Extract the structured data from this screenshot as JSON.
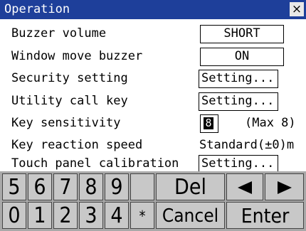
{
  "window": {
    "title": "Operation",
    "close_label": "×"
  },
  "settings": [
    {
      "label": "Buzzer volume",
      "value": "SHORT"
    },
    {
      "label": "Window move buzzer",
      "value": "ON"
    },
    {
      "label": "Security setting",
      "value": "Setting..."
    },
    {
      "label": "Utility call key",
      "value": "Setting..."
    },
    {
      "label": "Key sensitivity",
      "value": "8",
      "note": "(Max 8)"
    },
    {
      "label": "Key reaction speed",
      "value": "Standard(±0)m"
    },
    {
      "label": "Touch panel calibration",
      "value": "Setting..."
    }
  ],
  "keypad": {
    "row1": [
      "5",
      "6",
      "7",
      "8",
      "9",
      "",
      "Del"
    ],
    "row2": [
      "0",
      "1",
      "2",
      "3",
      "4",
      "*",
      "Cancel",
      "Enter"
    ],
    "arrows": {
      "left": "left-arrow-icon",
      "right": "right-arrow-icon"
    }
  }
}
